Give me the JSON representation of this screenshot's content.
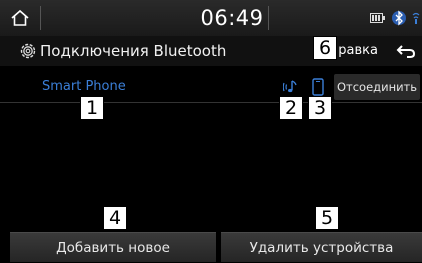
{
  "status_bar": {
    "time": "06:49",
    "icons": [
      "home-icon",
      "media-icon",
      "bluetooth-status-icon",
      "signal-icon"
    ]
  },
  "header": {
    "title": "Подключения Bluetooth",
    "edit_label": "равка",
    "icons": [
      "settings-gear-icon",
      "back-arrow-icon"
    ]
  },
  "device_list": [
    {
      "name": "Smart Phone",
      "name_color": "#3b7fd8",
      "audio_icon": "bluetooth-audio-icon",
      "phone_icon": "phone-icon",
      "action_label": "Отсоединить"
    }
  ],
  "bottom_buttons": {
    "add_label": "Добавить новое",
    "delete_label": "Удалить устройства"
  },
  "callouts": [
    "1",
    "2",
    "3",
    "4",
    "5",
    "6"
  ],
  "colors": {
    "accent": "#3b7fd8",
    "audio_icon": "#3b7fd8",
    "background": "#000000"
  }
}
